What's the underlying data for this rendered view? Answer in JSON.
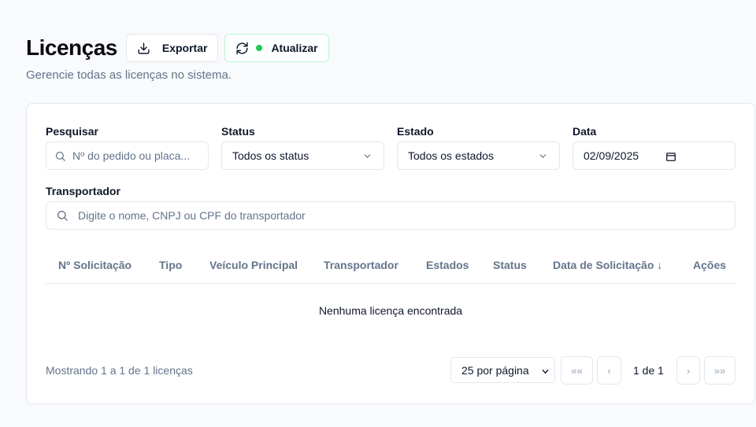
{
  "header": {
    "title": "Licenças",
    "subtitle": "Gerencie todas as licenças no sistema.",
    "export_label": "Exportar",
    "update_label": "Atualizar"
  },
  "filters": {
    "search_label": "Pesquisar",
    "search_placeholder": "Nº do pedido ou placa...",
    "status_label": "Status",
    "status_value": "Todos os status",
    "state_label": "Estado",
    "state_value": "Todos os estados",
    "date_label": "Data",
    "date_value": "02/09/2025",
    "carrier_label": "Transportador",
    "carrier_placeholder": "Digite o nome, CNPJ ou CPF do transportador"
  },
  "table": {
    "columns": [
      "Nº Solicitação",
      "Tipo",
      "Veículo Principal",
      "Transportador",
      "Estados",
      "Status",
      "Data de Solicitação ↓",
      "Ações"
    ],
    "empty_message": "Nenhuma licença encontrada"
  },
  "pagination": {
    "summary": "Mostrando 1 a 1 de 1 licenças",
    "per_page": "25 por página",
    "first": "««",
    "prev": "‹",
    "page_info": "1 de 1",
    "next": "›",
    "last": "»»"
  },
  "colors": {
    "accent_green": "#22c55e",
    "border": "#e2e8f0",
    "muted_text": "#64748b"
  }
}
